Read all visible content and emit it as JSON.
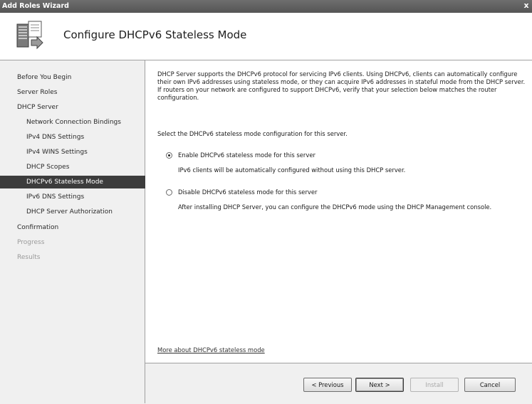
{
  "window": {
    "title": "Add Roles Wizard",
    "close_glyph": "x"
  },
  "header": {
    "title": "Configure DHCPv6 Stateless Mode",
    "icon": "server-wizard-icon"
  },
  "sidebar": {
    "items": [
      {
        "label": "Before You Begin",
        "state": "normal",
        "indent": 0
      },
      {
        "label": "Server Roles",
        "state": "normal",
        "indent": 0
      },
      {
        "label": "DHCP Server",
        "state": "normal",
        "indent": 0
      },
      {
        "label": "Network Connection Bindings",
        "state": "normal",
        "indent": 1
      },
      {
        "label": "IPv4 DNS Settings",
        "state": "normal",
        "indent": 1
      },
      {
        "label": "IPv4 WINS Settings",
        "state": "normal",
        "indent": 1
      },
      {
        "label": "DHCP Scopes",
        "state": "normal",
        "indent": 1
      },
      {
        "label": "DHCPv6 Stateless Mode",
        "state": "selected",
        "indent": 1
      },
      {
        "label": "IPv6 DNS Settings",
        "state": "normal",
        "indent": 1
      },
      {
        "label": "DHCP Server Authorization",
        "state": "normal",
        "indent": 1
      },
      {
        "label": "Confirmation",
        "state": "normal",
        "indent": 0
      },
      {
        "label": "Progress",
        "state": "disabled",
        "indent": 0
      },
      {
        "label": "Results",
        "state": "disabled",
        "indent": 0
      }
    ]
  },
  "main": {
    "intro": "DHCP Server supports the DHCPv6 protocol for servicing IPv6 clients. Using DHCPv6, clients can automatically configure their own IPv6 addresses using stateless mode, or they can acquire IPv6 addresses in stateful mode from the DHCP server. If routers on your network are configured to support DHCPv6, verify that your selection below matches the router configuration.",
    "prompt": "Select the DHCPv6 stateless mode configuration for this server.",
    "options": [
      {
        "label": "Enable DHCPv6 stateless mode for this server",
        "description": "IPv6 clients will be automatically configured without using this DHCP server.",
        "selected": true
      },
      {
        "label": "Disable DHCPv6 stateless mode for this server",
        "description": "After installing DHCP Server, you can configure the DHCPv6 mode using the DHCP Management console.",
        "selected": false
      }
    ],
    "more_link": "More about DHCPv6 stateless mode"
  },
  "footer": {
    "previous_label": "< Previous",
    "next_label": "Next >",
    "install_label": "Install",
    "cancel_label": "Cancel"
  },
  "colors": {
    "selected_bg": "#3c3c3c",
    "sidebar_bg": "#f0f0f0",
    "titlebar": "#5f5f5f",
    "disabled_text": "#9a9a9a"
  }
}
